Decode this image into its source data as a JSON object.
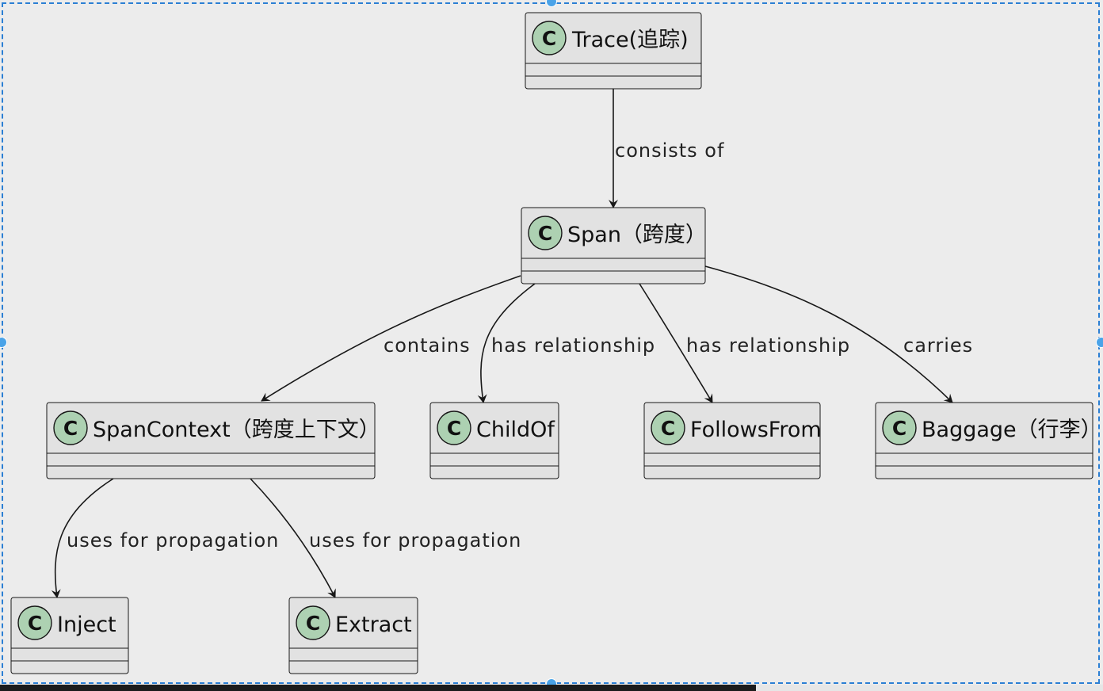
{
  "diagram": {
    "classes": [
      {
        "id": "trace",
        "stereotype": "C",
        "name": "Trace(追踪)"
      },
      {
        "id": "span",
        "stereotype": "C",
        "name": "Span（跨度）"
      },
      {
        "id": "spancontext",
        "stereotype": "C",
        "name": "SpanContext（跨度上下文）"
      },
      {
        "id": "childof",
        "stereotype": "C",
        "name": "ChildOf"
      },
      {
        "id": "followsfrom",
        "stereotype": "C",
        "name": "FollowsFrom"
      },
      {
        "id": "baggage",
        "stereotype": "C",
        "name": "Baggage（行李）"
      },
      {
        "id": "inject",
        "stereotype": "C",
        "name": "Inject"
      },
      {
        "id": "extract",
        "stereotype": "C",
        "name": "Extract"
      }
    ],
    "edges": [
      {
        "from": "trace",
        "to": "span",
        "label": "consists of"
      },
      {
        "from": "span",
        "to": "spancontext",
        "label": "contains"
      },
      {
        "from": "span",
        "to": "childof",
        "label": "has relationship"
      },
      {
        "from": "span",
        "to": "followsfrom",
        "label": "has relationship"
      },
      {
        "from": "span",
        "to": "baggage",
        "label": "carries"
      },
      {
        "from": "spancontext",
        "to": "inject",
        "label": "uses for propagation"
      },
      {
        "from": "spancontext",
        "to": "extract",
        "label": "uses for propagation"
      }
    ]
  },
  "colors": {
    "background": "#ececec",
    "class_fill": "#e2e2e2",
    "class_border": "#181818",
    "circle_fill": "#add1b2",
    "edge": "#181818",
    "selection": "#2b7fd4"
  }
}
